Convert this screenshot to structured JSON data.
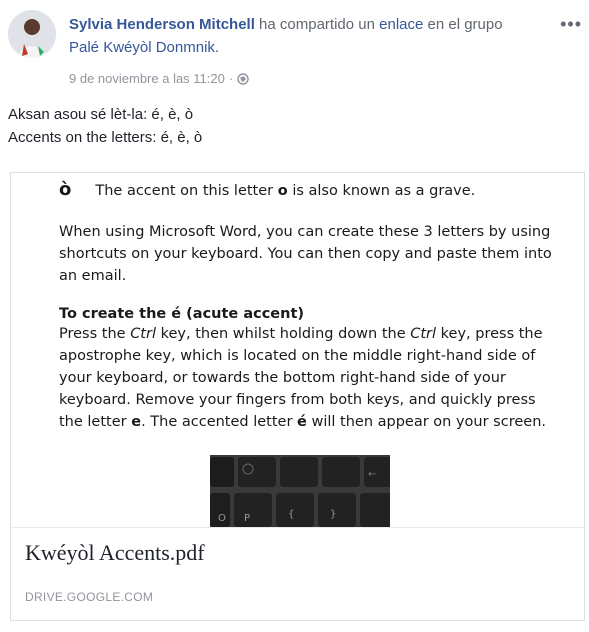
{
  "post": {
    "author": "Sylvia Henderson Mitchell",
    "action_text": " ha compartido un ",
    "link_word": "enlace",
    "group_prefix": " en el grupo",
    "group_name": "Palé Kwéyòl Donmnik.",
    "timestamp": "9 de noviembre a las 11:20",
    "separator": "·",
    "privacy_icon": "globe-icon",
    "more_label": "•••",
    "text_line1": "Aksan asou sé lèt-la: é, è, ò",
    "text_line2": "Accents on the letters: é, è, ò"
  },
  "attachment": {
    "preview": {
      "grave_letter": "ò",
      "grave_line_a": "The accent on this letter ",
      "grave_line_o": "o",
      "grave_line_b": " is also known as a grave.",
      "paragraph1": "When using Microsoft Word, you can create these 3 letters by using shortcuts on your keyboard.  You can then copy and paste them into an email.",
      "heading": "To create the é (acute accent)",
      "p2_a": "Press the ",
      "p2_ctrl1": "Ctrl",
      "p2_b": " key, then whilst holding down the ",
      "p2_ctrl2": "Ctrl",
      "p2_c": " key, press the apostrophe key, which is located on the middle right-hand side of your keyboard, or towards the bottom right-hand side of your keyboard.  Remove your fingers from both keys, and quickly press the letter ",
      "p2_e": "e",
      "p2_d": ". The accented letter ",
      "p2_eacute": "é",
      "p2_f": " will then appear on your screen."
    },
    "title": "Kwéyòl Accents.pdf",
    "source": "DRIVE.GOOGLE.COM"
  },
  "colors": {
    "link": "#365899",
    "meta": "#90949c",
    "border": "#dddfe2"
  }
}
